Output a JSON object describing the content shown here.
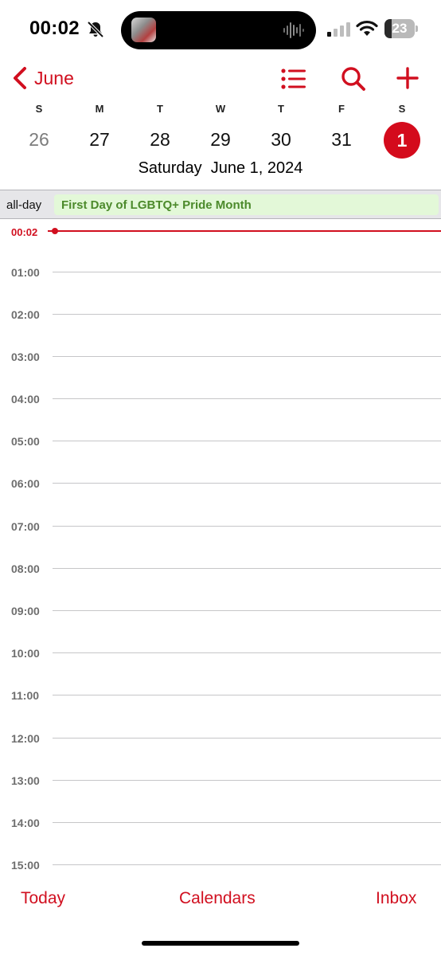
{
  "status_bar": {
    "time": "00:02",
    "battery": "23",
    "battery_level": 0.23,
    "icons": [
      "bell-slash-icon",
      "signal-icon",
      "wifi-icon",
      "battery-icon"
    ]
  },
  "nav": {
    "back_label": "June",
    "icons": [
      "chevron-left-icon",
      "list-icon",
      "search-icon",
      "plus-icon"
    ]
  },
  "week": {
    "letters": [
      "S",
      "M",
      "T",
      "W",
      "T",
      "F",
      "S"
    ],
    "days": [
      "26",
      "27",
      "28",
      "29",
      "30",
      "31",
      "1"
    ],
    "selected_index": 6
  },
  "selected_date": "Saturday  June 1, 2024",
  "all_day": {
    "label": "all-day",
    "event": "First Day of LGBTQ+ Pride Month"
  },
  "timeline": {
    "now": "00:02",
    "hours": [
      "01:00",
      "02:00",
      "03:00",
      "04:00",
      "05:00",
      "06:00",
      "07:00",
      "08:00",
      "09:00",
      "10:00",
      "11:00",
      "12:00",
      "13:00",
      "14:00",
      "15:00"
    ]
  },
  "tabs": {
    "today": "Today",
    "calendars": "Calendars",
    "inbox": "Inbox"
  },
  "colors": {
    "accent": "#d10f1f",
    "event_bg": "#e3f8d8",
    "event_text": "#4c8a2b"
  }
}
